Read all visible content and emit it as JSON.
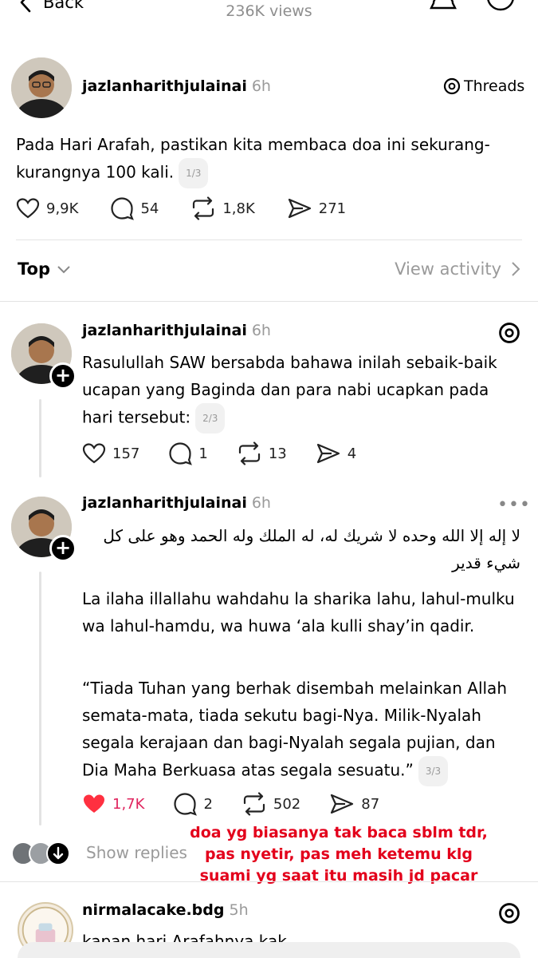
{
  "header": {
    "back_label": "Back",
    "views": "236K views"
  },
  "main_post": {
    "username": "jazlanharithjulainai",
    "time": "6h",
    "platform_label": "Threads",
    "text": "Pada Hari Arafah, pastikan kita membaca doa ini sekurang-kurangnya 100 kali.",
    "counter": "1/3",
    "likes": "9,9K",
    "replies": "54",
    "reposts": "1,8K",
    "shares": "271"
  },
  "sort": {
    "label": "Top",
    "view_activity": "View activity"
  },
  "reply1": {
    "username": "jazlanharithjulainai",
    "time": "6h",
    "text": "Rasulullah SAW bersabda bahawa inilah sebaik-baik ucapan yang Baginda dan para nabi ucapkan pada hari tersebut:",
    "counter": "2/3",
    "likes": "157",
    "replies": "1",
    "reposts": "13",
    "shares": "4"
  },
  "reply2": {
    "username": "jazlanharithjulainai",
    "time": "6h",
    "arabic": "لا إله إلا الله وحده لا شريك له، له الملك وله الحمد وهو على كل شيء قدير",
    "transliteration": "La ilaha illallahu wahdahu la sharika lahu, lahul-mulku wa lahul-hamdu, wa huwa ‘ala kulli shay’in qadir.",
    "translation": "“Tiada Tuhan yang berhak disembah melainkan Allah semata-mata, tiada sekutu bagi-Nya. Milik-Nyalah segala kerajaan dan bagi-Nyalah segala pujian, dan Dia Maha Berkuasa atas segala sesuatu.”",
    "counter": "3/3",
    "likes": "1,7K",
    "replies": "2",
    "reposts": "502",
    "shares": "87",
    "like_color": "#e0245e"
  },
  "show_replies": "Show replies",
  "overlay_note": "doa yg biasanya tak baca sblm tdr, pas nyetir, pas meh ketemu klg suami yg saat itu masih jd pacar",
  "reply3": {
    "username": "nirmalacake.bdg",
    "time": "5h",
    "text": "kapan hari Arafahnya kak"
  },
  "colors": {
    "accent_red": "#e3001b",
    "muted": "#8e8e8e",
    "divider": "#e3e3e3"
  }
}
